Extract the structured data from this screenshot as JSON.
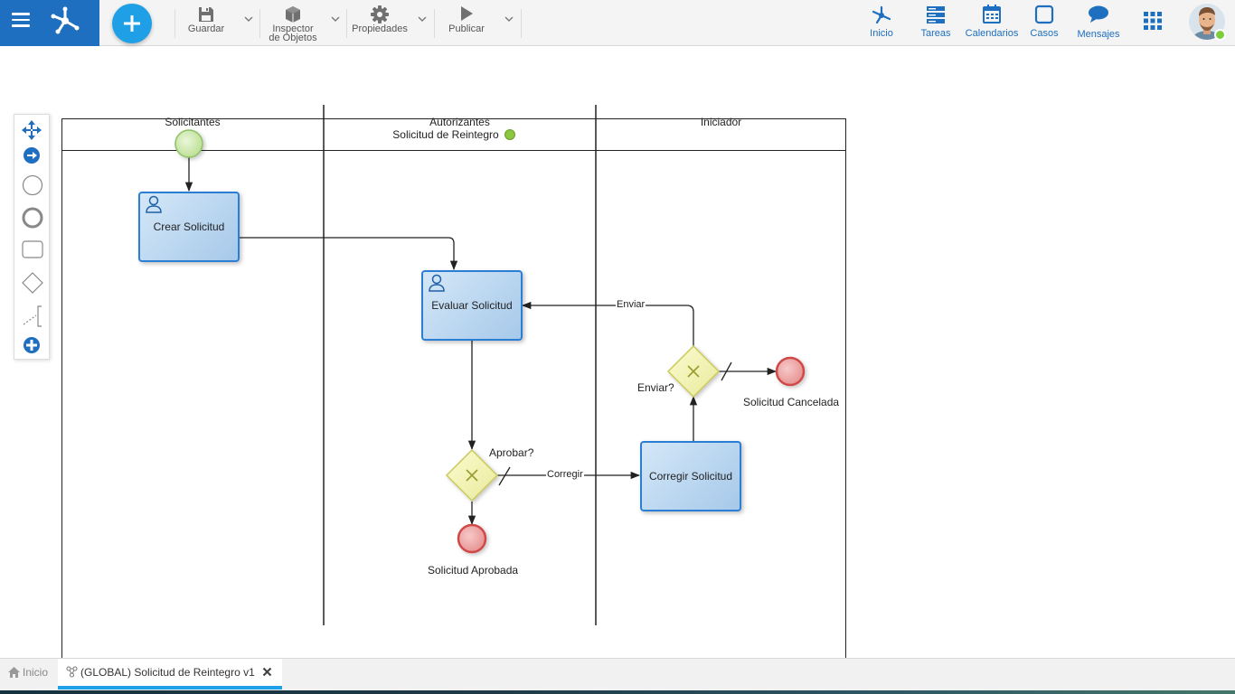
{
  "toolbar": {
    "save_label": "Guardar",
    "inspector_label": "Inspector de Objetos",
    "properties_label": "Propiedades",
    "publish_label": "Publicar"
  },
  "nav": {
    "home": "Inicio",
    "tasks": "Tareas",
    "calendars": "Calendarios",
    "cases": "Casos",
    "messages": "Mensajes"
  },
  "diagram": {
    "pool_title": "Solicitud de Reintegro",
    "pool_status_color": "#8cc63e",
    "lanes": [
      "Solicitantes",
      "Autorizantes",
      "Iniciador"
    ],
    "tasks": {
      "create": "Crear Solicitud",
      "evaluate": "Evaluar Solicitud",
      "correct": "Corregir Solicitud"
    },
    "gateways": {
      "approve": "Aprobar?",
      "send": "Enviar?"
    },
    "events": {
      "approved": "Solicitud Aprobada",
      "cancelled": "Solicitud Cancelada"
    },
    "flows": {
      "correct": "Corregir",
      "send": "Enviar"
    }
  },
  "tabs": {
    "home": "Inicio",
    "process": "(GLOBAL) Solicitud de Reintegro v1"
  },
  "colors": {
    "brand": "#1e6fbf",
    "accent": "#1fa0e6",
    "task_border": "#2a7fd4",
    "gateway": "#f2f2a8",
    "end_event": "#e05a5a",
    "start_event": "#c8e6a3"
  }
}
